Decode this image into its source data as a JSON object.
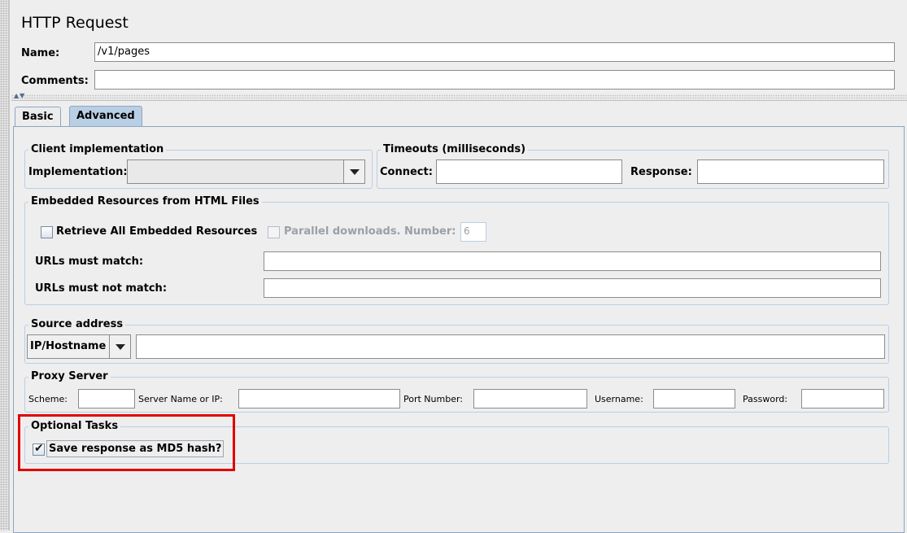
{
  "window": {
    "title": "HTTP Request"
  },
  "form": {
    "name_label": "Name:",
    "name_value": "/v1/pages",
    "comments_label": "Comments:",
    "comments_value": ""
  },
  "tabs": [
    {
      "label": "Basic",
      "selected": false
    },
    {
      "label": "Advanced",
      "selected": true
    }
  ],
  "client_implementation": {
    "group_title": "Client implementation",
    "implementation_label": "Implementation:",
    "implementation_value": ""
  },
  "timeouts": {
    "group_title": "Timeouts (milliseconds)",
    "connect_label": "Connect:",
    "connect_value": "",
    "response_label": "Response:",
    "response_value": ""
  },
  "embedded_resources": {
    "group_title": "Embedded Resources from HTML Files",
    "retrieve_all_label": "Retrieve All Embedded Resources",
    "retrieve_all_checked": false,
    "parallel_label": "Parallel downloads. Number:",
    "parallel_checked": false,
    "parallel_number": "6",
    "urls_match_label": "URLs must match:",
    "urls_match_value": "",
    "urls_not_match_label": "URLs must not match:",
    "urls_not_match_value": ""
  },
  "source_address": {
    "group_title": "Source address",
    "type_value": "IP/Hostname",
    "address_value": ""
  },
  "proxy_server": {
    "group_title": "Proxy Server",
    "scheme_label": "Scheme:",
    "server_label": "Server Name or IP:",
    "port_label": "Port Number:",
    "username_label": "Username:",
    "password_label": "Password:"
  },
  "optional_tasks": {
    "group_title": "Optional Tasks",
    "md5_label": "Save response as MD5 hash?",
    "md5_checked": true
  },
  "colors": {
    "highlight": "#e10000",
    "selected_tab": "#b9cfe5"
  }
}
